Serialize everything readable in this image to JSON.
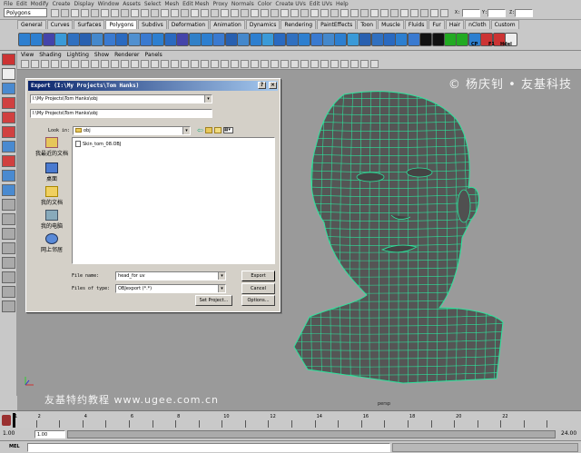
{
  "menubar": [
    "File",
    "Edit",
    "Modify",
    "Create",
    "Display",
    "Window",
    "Assets",
    "Select",
    "Mesh",
    "Edit Mesh",
    "Proxy",
    "Normals",
    "Color",
    "Create UVs",
    "Edit UVs",
    "Help"
  ],
  "status_line": {
    "mode": "Polygons",
    "fields": [
      "X:",
      "Y:",
      "Z:"
    ]
  },
  "shelf_tabs": [
    "General",
    "Curves",
    "Surfaces",
    "Polygons",
    "Subdivs",
    "Deformation",
    "Animation",
    "Dynamics",
    "Rendering",
    "PaintEffects",
    "Toon",
    "Muscle",
    "Fluids",
    "Fur",
    "Hair",
    "nCloth",
    "Custom"
  ],
  "active_shelf_tab": "Polygons",
  "shelf_extra_labels": [
    "CP",
    "F1",
    "Hdel"
  ],
  "panel_menu": [
    "View",
    "Shading",
    "Lighting",
    "Show",
    "Renderer",
    "Panels"
  ],
  "viewport": {
    "camera_label": "persp",
    "watermark_top": "© 杨庆钊 • 友基科技",
    "watermark_bottom": "友基特约教程  www.ugee.com.cn"
  },
  "dialog": {
    "title": "Export (I:\\My Projects\\Tom Hanks)",
    "path_combo": "I:\\My Projects\\Tom Hanks\\obj",
    "path_field": "I:\\My Projects\\Tom Hanks\\obj",
    "look_in_label": "Look in:",
    "look_in_value": "obj",
    "places": [
      "我最近的文档",
      "桌面",
      "我的文档",
      "我的电脑",
      "网上邻居"
    ],
    "files": [
      "Skin_tom_08.OBJ"
    ],
    "file_name_label": "File name:",
    "file_name_value": "head_for uv",
    "files_of_type_label": "Files of type:",
    "files_of_type_value": "OBJexport (*.*)",
    "export_button": "Export",
    "cancel_button": "Cancel",
    "set_project_button": "Set Project...",
    "options_button": "Options..."
  },
  "timeline": {
    "ticks": [
      "1",
      "2",
      "4",
      "6",
      "8",
      "10",
      "12",
      "14",
      "16",
      "18",
      "20",
      "22"
    ],
    "current_frame": "1"
  },
  "range": {
    "start": "1.00",
    "playback_start": "1.00",
    "end": "24.00"
  },
  "command_line": {
    "label": "MEL"
  },
  "colors": {
    "wireframe": "#2de39c",
    "mesh_fill": "#555555",
    "viewport_bg": "#9a9a9a",
    "dialog_title_start": "#0a246a",
    "dialog_title_end": "#a6caf0"
  }
}
